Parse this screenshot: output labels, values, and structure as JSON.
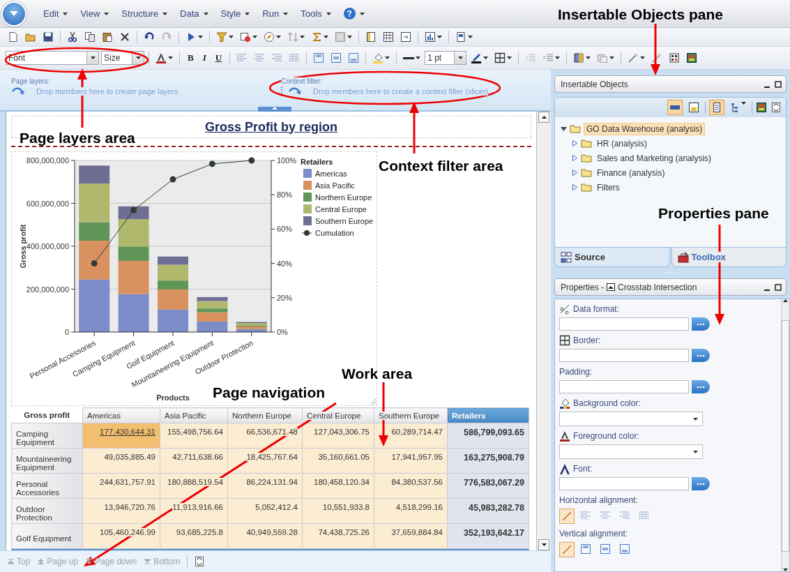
{
  "menu": {
    "items": [
      {
        "label": "Edit"
      },
      {
        "label": "View"
      },
      {
        "label": "Structure"
      },
      {
        "label": "Data"
      },
      {
        "label": "Style"
      },
      {
        "label": "Run"
      },
      {
        "label": "Tools"
      }
    ],
    "help": "?"
  },
  "format_bar": {
    "font": "Font",
    "size": "Size",
    "bold": "B",
    "italic": "I",
    "underline": "U",
    "line_weight": "1 pt"
  },
  "page_layers": {
    "label": "Page layers:",
    "hint": "Drop members here to create page layers"
  },
  "context_filter": {
    "label": "Context filter:",
    "hint": "Drop members here to create a context filter (slicer)"
  },
  "report": {
    "title": "Gross Profit by region",
    "chart_data": {
      "type": "bar",
      "stacked": true,
      "xlabel": "Products",
      "ylabel": "Gross profit",
      "grid": true,
      "legend": {
        "title": "Retailers"
      },
      "categories": [
        "Personal Accessories",
        "Camping Equipment",
        "Golf Equipment",
        "Mountaineering Equipment",
        "Outdoor Protection"
      ],
      "series": [
        {
          "name": "Americas",
          "color": "#7b8cc8",
          "values": [
            245000000,
            177000000,
            105000000,
            49000000,
            14000000
          ]
        },
        {
          "name": "Asia Pacific",
          "color": "#d9915f",
          "values": [
            181000000,
            155000000,
            94000000,
            43000000,
            12000000
          ]
        },
        {
          "name": "Northern Europe",
          "color": "#5f9658",
          "values": [
            86000000,
            67000000,
            41000000,
            18000000,
            5000000
          ]
        },
        {
          "name": "Central Europe",
          "color": "#b0b86e",
          "values": [
            180000000,
            127000000,
            74000000,
            35000000,
            11000000
          ]
        },
        {
          "name": "Southern Europe",
          "color": "#6e6e94",
          "values": [
            84000000,
            60000000,
            38000000,
            18000000,
            5000000
          ]
        },
        {
          "name": "Cumulation",
          "color": "#2f3a30",
          "type": "line",
          "marker": "circle",
          "axis": "y2",
          "values": [
            0.4,
            0.71,
            0.89,
            0.98,
            1.0
          ]
        }
      ],
      "ylim": [
        0,
        800000000
      ],
      "yticks": [
        {
          "value": 0,
          "label": "0"
        },
        {
          "value": 200000000,
          "label": "200,000,000"
        },
        {
          "value": 400000000,
          "label": "400,000,000"
        },
        {
          "value": 600000000,
          "label": "600,000,000"
        },
        {
          "value": 800000000,
          "label": "800,000,000"
        }
      ],
      "y2lim": [
        0,
        1
      ],
      "y2ticks": [
        {
          "value": 0,
          "label": "0%"
        },
        {
          "value": 0.2,
          "label": "20%"
        },
        {
          "value": 0.4,
          "label": "40%"
        },
        {
          "value": 0.6,
          "label": "60%"
        },
        {
          "value": 0.8,
          "label": "80%"
        },
        {
          "value": 1,
          "label": "100%"
        }
      ]
    },
    "crosstab": {
      "corner": "Gross profit",
      "columns": [
        {
          "label": "Americas",
          "kind": "member"
        },
        {
          "label": "Asia Pacific",
          "kind": "member"
        },
        {
          "label": "Northern Europe",
          "kind": "member"
        },
        {
          "label": "Central Europe",
          "kind": "member"
        },
        {
          "label": "Southern Europe",
          "kind": "member"
        },
        {
          "label": "Retailers",
          "kind": "total"
        }
      ],
      "rows": [
        {
          "label": "Camping Equipment",
          "cells": [
            {
              "value": "177,430,644.31",
              "selected": true
            },
            {
              "value": "155,498,756.64",
              "selected": false
            },
            {
              "value": "66,536,671.48",
              "selected": false
            },
            {
              "value": "127,043,306.75",
              "selected": false
            },
            {
              "value": "60,289,714.47",
              "selected": false
            },
            {
              "value": "586,799,093.65",
              "selected": false
            }
          ]
        },
        {
          "label": "Mountaineering Equipment",
          "cells": [
            {
              "value": "49,035,885.49",
              "selected": false
            },
            {
              "value": "42,711,638.66",
              "selected": false
            },
            {
              "value": "18,425,767.64",
              "selected": false
            },
            {
              "value": "35,160,661.05",
              "selected": false
            },
            {
              "value": "17,941,957.95",
              "selected": false
            },
            {
              "value": "163,275,908.79",
              "selected": false
            }
          ]
        },
        {
          "label": "Personal Accessories",
          "cells": [
            {
              "value": "244,631,757.91",
              "selected": false
            },
            {
              "value": "180,888,519.54",
              "selected": false
            },
            {
              "value": "86,224,131.94",
              "selected": false
            },
            {
              "value": "180,458,120.34",
              "selected": false
            },
            {
              "value": "84,380,537.56",
              "selected": false
            },
            {
              "value": "776,583,067.29",
              "selected": false
            }
          ]
        },
        {
          "label": "Outdoor Protection",
          "cells": [
            {
              "value": "13,946,720.76",
              "selected": false
            },
            {
              "value": "11,913,916.66",
              "selected": false
            },
            {
              "value": "5,052,412.4",
              "selected": false
            },
            {
              "value": "10,551,933.8",
              "selected": false
            },
            {
              "value": "4,518,299.16",
              "selected": false
            },
            {
              "value": "45,983,282.78",
              "selected": false
            }
          ]
        },
        {
          "label": "Golf Equipment",
          "cells": [
            {
              "value": "105,460,246.99",
              "selected": false
            },
            {
              "value": "93,685,225.8",
              "selected": false
            },
            {
              "value": "40,949,559.28",
              "selected": false
            },
            {
              "value": "74,438,725.26",
              "selected": false
            },
            {
              "value": "37,659,884.84",
              "selected": false
            },
            {
              "value": "352,193,642.17",
              "selected": false
            }
          ]
        }
      ]
    }
  },
  "page_navigation": [
    {
      "label": "Top",
      "disabled": true
    },
    {
      "label": "Page up",
      "disabled": true
    },
    {
      "label": "Page down",
      "disabled": true
    },
    {
      "label": "Bottom",
      "disabled": true
    }
  ],
  "insertable_objects": {
    "title": "Insertable Objects",
    "tree": [
      {
        "label": "GO Data Warehouse (analysis)",
        "expanded": true,
        "selected": true,
        "children": [
          {
            "label": "HR (analysis)",
            "expanded": false,
            "selected": false
          },
          {
            "label": "Sales and Marketing (analysis)",
            "expanded": false,
            "selected": false
          },
          {
            "label": "Finance (analysis)",
            "expanded": false,
            "selected": false
          },
          {
            "label": "Filters",
            "expanded": false,
            "selected": false
          }
        ]
      }
    ],
    "tabs": [
      {
        "label": "Source",
        "selected": true
      },
      {
        "label": "Toolbox",
        "selected": false
      }
    ]
  },
  "properties": {
    "title": "Properties -",
    "object": "Crosstab Intersection",
    "items": [
      {
        "kind": "text-button",
        "label": "Data format:"
      },
      {
        "kind": "text-button",
        "label": "Border:"
      },
      {
        "kind": "text-button",
        "label": "Padding:"
      },
      {
        "kind": "dropdown",
        "label": "Background color:"
      },
      {
        "kind": "dropdown",
        "label": "Foreground color:"
      },
      {
        "kind": "text-button",
        "label": "Font:"
      },
      {
        "kind": "options",
        "label": "Horizontal alignment:",
        "options": [
          {
            "selected": true
          },
          {
            "selected": false
          },
          {
            "selected": false
          },
          {
            "selected": false
          },
          {
            "selected": false
          }
        ]
      },
      {
        "kind": "options",
        "label": "Vertical alignment:",
        "options": [
          {
            "selected": true
          },
          {
            "selected": false
          },
          {
            "selected": false
          },
          {
            "selected": false
          }
        ]
      }
    ]
  },
  "annotations": [
    {
      "text": "Insertable Objects pane"
    },
    {
      "text": "Page layers area"
    },
    {
      "text": "Context filter area"
    },
    {
      "text": "Properties pane"
    },
    {
      "text": "Work area"
    },
    {
      "text": "Page navigation"
    }
  ]
}
